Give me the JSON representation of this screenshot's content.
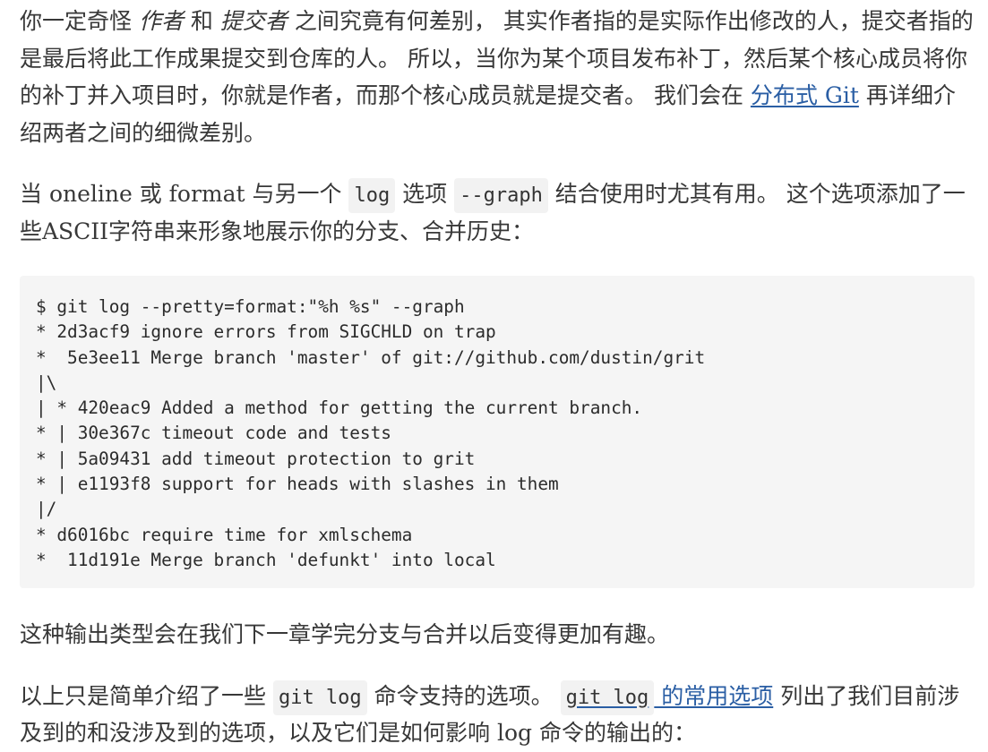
{
  "paragraph_1": {
    "text_1": "你一定奇怪 ",
    "emphasis_1": "作者",
    "text_2": " 和 ",
    "emphasis_2": "提交者",
    "text_3": " 之间究竟有何差别， 其实作者指的是实际作出修改的人，提交者指的是最后将此工作成果提交到仓库的人。 所以，当你为某个项目发布补丁，然后某个核心成员将你的补丁并入项目时，你就是作者，而那个核心成员就是提交者。 我们会在 ",
    "link": "分布式 Git",
    "text_4": " 再详细介绍两者之间的细微差别。"
  },
  "paragraph_2": {
    "text_1": "当 oneline 或 format 与另一个 ",
    "code_1": "log",
    "text_2": " 选项 ",
    "code_2": "--graph",
    "text_3": " 结合使用时尤其有用。 这个选项添加了一些ASCII字符串来形象地展示你的分支、合并历史："
  },
  "code_block": {
    "lines": [
      "$ git log --pretty=format:\"%h %s\" --graph",
      "* 2d3acf9 ignore errors from SIGCHLD on trap",
      "*  5e3ee11 Merge branch 'master' of git://github.com/dustin/grit",
      "|\\",
      "| * 420eac9 Added a method for getting the current branch.",
      "* | 30e367c timeout code and tests",
      "* | 5a09431 add timeout protection to grit",
      "* | e1193f8 support for heads with slashes in them",
      "|/",
      "* d6016bc require time for xmlschema",
      "*  11d191e Merge branch 'defunkt' into local"
    ]
  },
  "paragraph_3": {
    "text": "这种输出类型会在我们下一章学完分支与合并以后变得更加有趣。"
  },
  "paragraph_4": {
    "text_1": "以上只是简单介绍了一些 ",
    "code_1": "git log",
    "text_2": " 命令支持的选项。 ",
    "link_code": "git log",
    "link_text": " 的常用选项",
    "text_3": " 列出了我们目前涉及到的和没涉及到的选项，以及它们是如何影响 log 命令的输出的："
  },
  "colors": {
    "text": "#383838",
    "link": "#2a5ea4",
    "code_background": "#f5f5f5",
    "inline_code_background": "#f2f2f2"
  }
}
